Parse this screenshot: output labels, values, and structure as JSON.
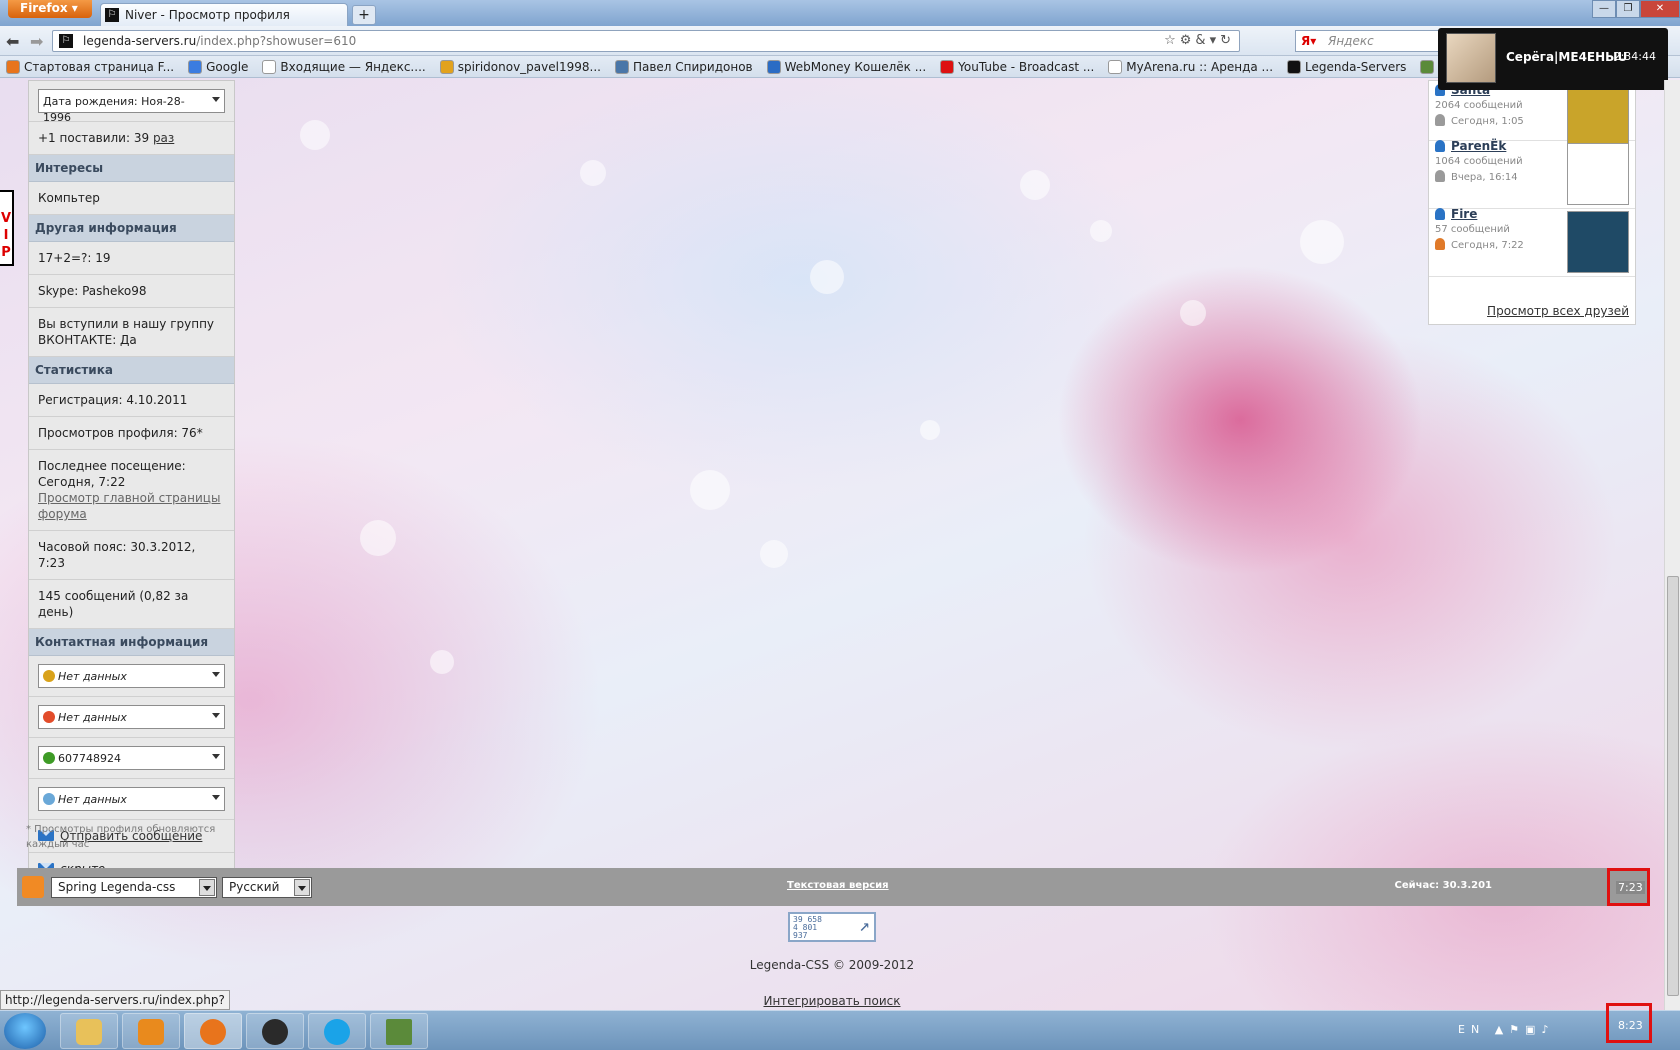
{
  "browser": {
    "app_button": "Firefox",
    "tab_title": "Niver - Просмотр профиля",
    "url_host": "legenda-servers.ru",
    "url_path": "/index.php?showuser=610",
    "search_placeholder": "Яндекс",
    "bookmarks": [
      {
        "label": "Стартовая страница F...",
        "icon": "firefox-icon",
        "color": "#e8741c"
      },
      {
        "label": "Google",
        "icon": "google-icon",
        "color": "#3b7ce0"
      },
      {
        "label": "Входящие — Яндекс....",
        "icon": "blank-page-icon",
        "color": "#ffffff"
      },
      {
        "label": "spiridonov_pavel1998...",
        "icon": "mail-ru-icon",
        "color": "#e2a21d"
      },
      {
        "label": "Павел Спиридонов",
        "icon": "vk-icon",
        "color": "#4a76a8"
      },
      {
        "label": "WebMoney Кошелёк ...",
        "icon": "webmoney-icon",
        "color": "#2b6cc4"
      },
      {
        "label": "YouTube - Broadcast ...",
        "icon": "youtube-icon",
        "color": "#d11"
      },
      {
        "label": "MyArena.ru :: Аренда ...",
        "icon": "blank-page-icon",
        "color": "#ffffff"
      },
      {
        "label": "Legenda-Servers",
        "icon": "legenda-icon",
        "color": "#111111"
      },
      {
        "label": "Minecraft Wiki",
        "icon": "minecraft-icon",
        "color": "#5b8a3a"
      },
      {
        "label": "MineCraft -",
        "icon": "minecraft-icon",
        "color": "#3b6b2a"
      }
    ],
    "status_url": "http://legenda-servers.ru/index.php?"
  },
  "profile": {
    "birthday_select": "Дата рождения: Ноя-28-1996",
    "plus_one_prefix": "+1 поставили: 39",
    "plus_one_link": "раз",
    "sections": {
      "interests": "Интересы",
      "other": "Другая информация",
      "stats": "Статистика",
      "contacts": "Контактная информация"
    },
    "interests_value": "Компьтер",
    "other": {
      "captcha": "17+2=?: 19",
      "skype": "Skype: Pasheko98",
      "vk_group": "Вы вступили в нашу группу ВКОНТАКТЕ: Да"
    },
    "stats": {
      "registered": "Регистрация: 4.10.2011",
      "views": "Просмотров профиля: 76*",
      "last_visit": "Последнее посещение: Сегодня, 7:22",
      "last_visit_link": "Просмотр главной страницы форума",
      "timezone": "Часовой пояс: 30.3.2012, 7:23",
      "posts": "145 сообщений (0,82 за день)"
    },
    "contacts": [
      {
        "value": "Нет данных",
        "icon": "aim-icon",
        "italic": true,
        "color": "#d9a21a"
      },
      {
        "value": "Нет данных",
        "icon": "msn-icon",
        "italic": true,
        "color": "#e24c2a"
      },
      {
        "value": "607748924",
        "icon": "icq-icon",
        "italic": false,
        "color": "#3e9b26"
      },
      {
        "value": "Нет данных",
        "icon": "yahoo-icon",
        "italic": true,
        "color": "#6aa8d8"
      }
    ],
    "send_message": "Отправить сообщение",
    "email_hidden": "скрыто",
    "footnote": "* Просмотры профиля обновляются каждый час",
    "side_badge": "VIP"
  },
  "friends": {
    "items": [
      {
        "name": "Santa",
        "posts": "2064 сообщений",
        "seen": "Сегодня, 1:05",
        "status_color": "#9a9a9a",
        "avatar_color": "#c9a42a"
      },
      {
        "name": "ParenЁk",
        "posts": "1064 сообщений",
        "seen": "Вчера, 16:14",
        "status_color": "#9a9a9a",
        "avatar_color": "#ffffff"
      },
      {
        "name": "Fire",
        "posts": "57 сообщений",
        "seen": "Сегодня, 7:22",
        "status_color": "#e07a2a",
        "avatar_color": "#1f4a66"
      }
    ],
    "view_all": "Просмотр всех друзей"
  },
  "notification": {
    "name": "Серёга|МЕ4ЕНЫU",
    "time": "2:34:44"
  },
  "footer": {
    "skin_select": "Spring Legenda-css",
    "lang_select": "Русский",
    "text_version": "Текстовая версия",
    "now": "Сейчас: 30.3.201",
    "clock": "7:23",
    "counter_lines": [
      "39 658",
      "4 801",
      "937"
    ],
    "copyright": "Legenda-CSS © 2009-2012",
    "integrate_search": "Интегрировать поиск"
  },
  "taskbar": {
    "lang": "EN",
    "clock": "8:23"
  }
}
